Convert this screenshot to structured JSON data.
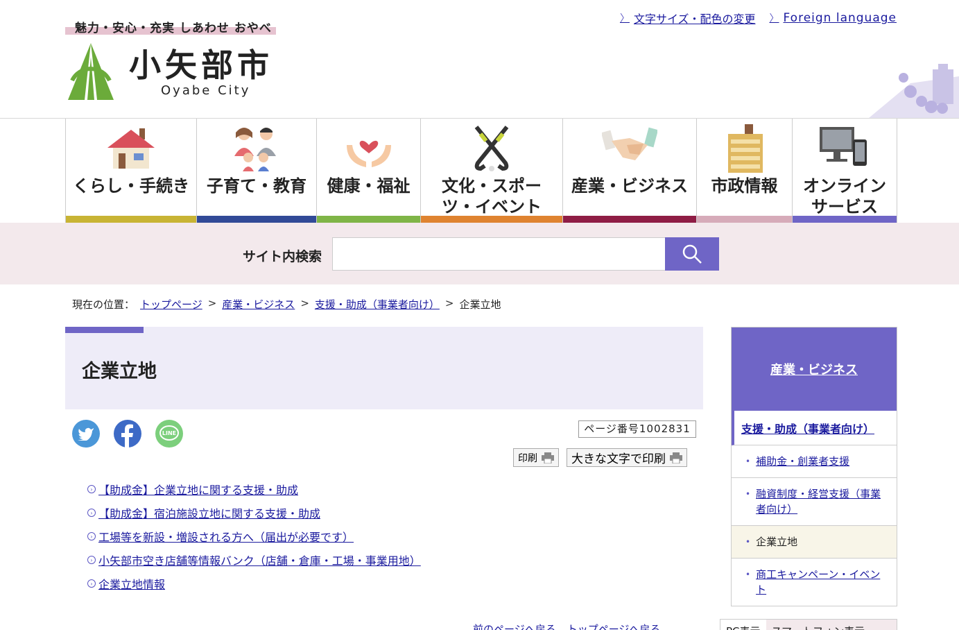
{
  "header": {
    "tagline": "魅力・安心・充実 しあわせ おやべ",
    "logo_title": "小矢部市",
    "logo_sub": "Oyabe City",
    "links": [
      {
        "label": "文字サイズ・配色の変更"
      },
      {
        "label": "Foreign language"
      }
    ]
  },
  "nav": [
    {
      "label": "くらし・手続き",
      "color": "#c8b434"
    },
    {
      "label": "子育て・教育",
      "color": "#314a97"
    },
    {
      "label": "健康・福祉",
      "color": "#7fb547"
    },
    {
      "label": "文化・スポーツ・イベント",
      "color": "#df8330"
    },
    {
      "label": "産業・ビジネス",
      "color": "#8f1d45"
    },
    {
      "label": "市政情報",
      "color": "#d6abb9"
    },
    {
      "label": "オンラインサービス",
      "color": "#6f65c6"
    }
  ],
  "search": {
    "label": "サイト内検索",
    "placeholder": "",
    "value": ""
  },
  "breadcrumb": {
    "prefix": "現在の位置：",
    "items": [
      "トップページ",
      "産業・ビジネス",
      "支援・助成（事業者向け）"
    ],
    "current": "企業立地"
  },
  "main": {
    "title": "企業立地",
    "page_number": "ページ番号1002831",
    "print_label": "印刷",
    "large_print_label": "大きな文字で印刷",
    "links": [
      "【助成金】企業立地に関する支援・助成",
      "【助成金】宿泊施設立地に関する支援・助成",
      "工場等を新設・増設される方へ（届出が必要です）",
      "小矢部市空き店舗等情報バンク（店舗・倉庫・工場・事業用地）",
      "企業立地情報"
    ]
  },
  "sidebar": {
    "head": "産業・ビジネス",
    "sub": "支援・助成（事業者向け）",
    "items": [
      {
        "label": "補助金・創業者支援"
      },
      {
        "label": "融資制度・経営支援（事業者向け）"
      },
      {
        "label": "企業立地"
      },
      {
        "label": "商工キャンペーン・イベント"
      }
    ]
  },
  "footer": {
    "prev": "前のページへ戻る",
    "top": "トップページへ戻る",
    "pc": "PC表示",
    "sp": "スマートフォン表示"
  }
}
